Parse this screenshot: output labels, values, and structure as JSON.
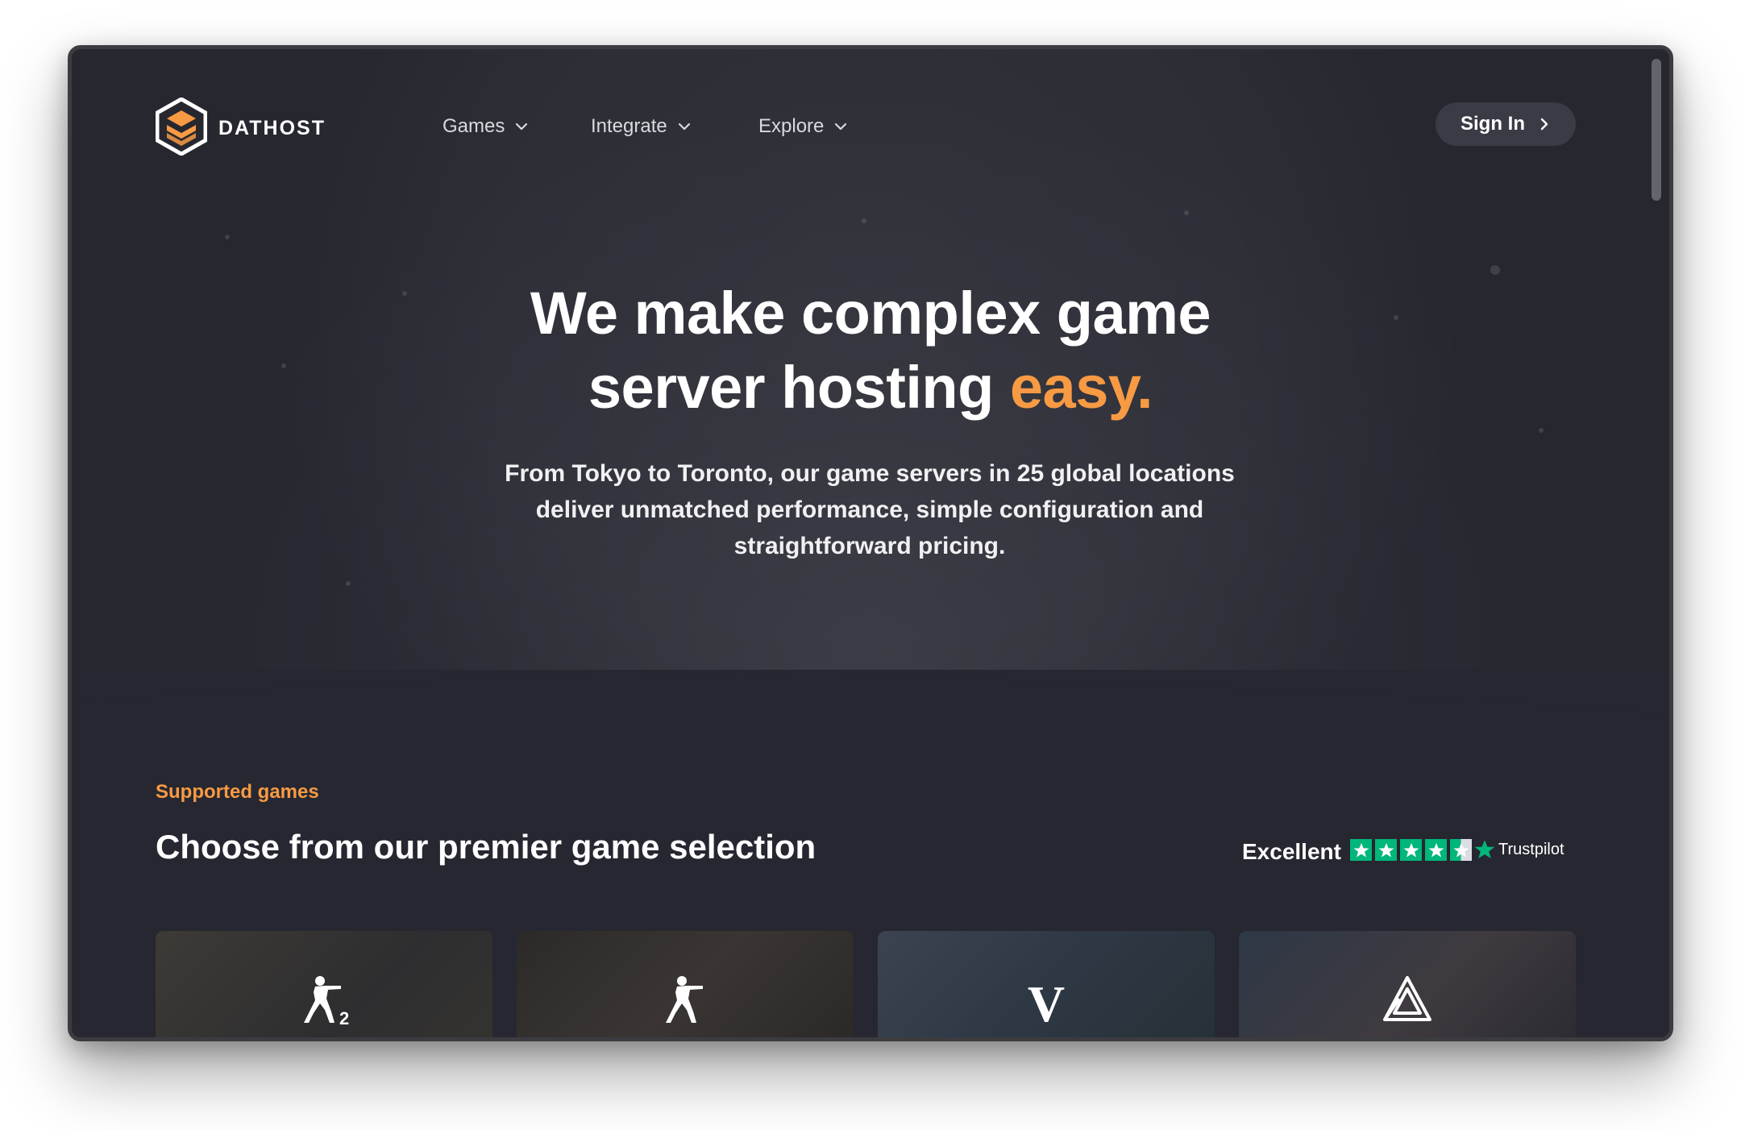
{
  "brand": {
    "name": "DATHOST",
    "logo_icon": "hexagon-stack-logo",
    "accent_color": "#f79a44"
  },
  "nav": {
    "items": [
      {
        "label": "Games",
        "icon": "chevron-down-icon"
      },
      {
        "label": "Integrate",
        "icon": "chevron-down-icon"
      },
      {
        "label": "Explore",
        "icon": "chevron-down-icon"
      }
    ],
    "signin_label": "Sign In",
    "signin_icon": "chevron-right-icon"
  },
  "hero": {
    "title_line1": "We make complex game",
    "title_line2_prefix": "server hosting ",
    "title_accent": "easy.",
    "subtitle": "From Tokyo to Toronto, our game servers in 25 global locations deliver unmatched performance, simple configuration and straightforward pricing."
  },
  "games_section": {
    "eyebrow": "Supported games",
    "title": "Choose from our premier game selection",
    "trustpilot": {
      "rating_label": "Excellent",
      "stars": 4.5,
      "brand": "Trustpilot",
      "star_color": "#00b67a"
    },
    "cards": [
      {
        "game_icon": "counter-strike-2-icon",
        "badge": "2"
      },
      {
        "game_icon": "counter-strike-icon"
      },
      {
        "game_icon": "valheim-icon",
        "glyph": "V"
      },
      {
        "game_icon": "ark-icon"
      }
    ]
  }
}
